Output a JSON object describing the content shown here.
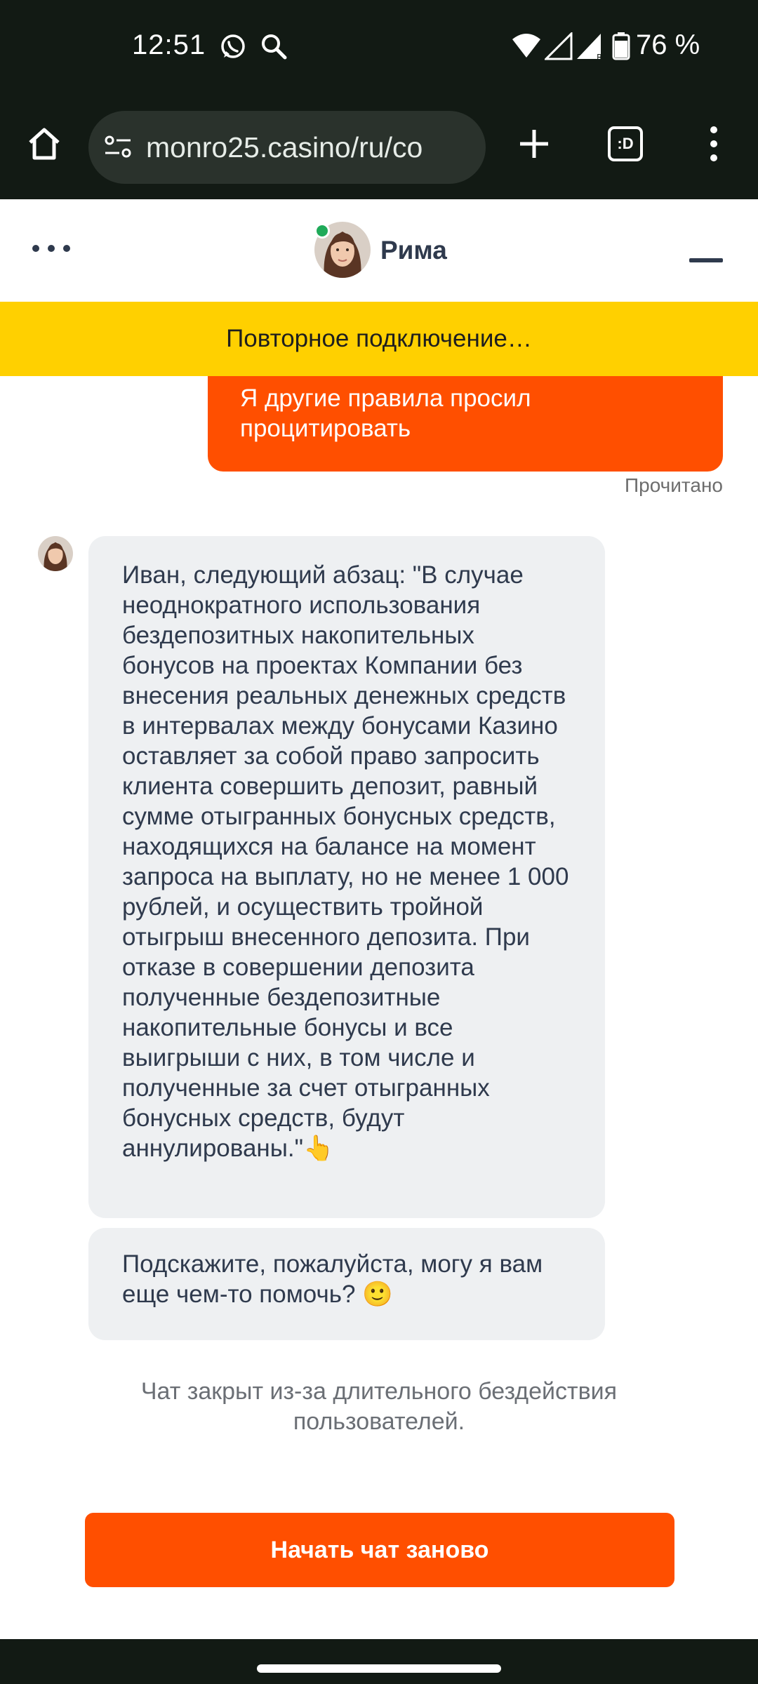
{
  "status_bar": {
    "time": "12:51",
    "battery": "76 %",
    "icons": [
      "whatsapp-icon",
      "search-icon",
      "wifi-icon",
      "signal-icon",
      "signal-roaming-icon",
      "battery-icon"
    ]
  },
  "browser": {
    "url": "monro25.casino/ru/co",
    "tab_count": ":D",
    "icons": [
      "home-icon",
      "site-settings-icon",
      "new-tab-icon",
      "tab-switcher-icon",
      "overflow-menu-icon"
    ]
  },
  "chat": {
    "agent_name": "Рима",
    "reconnect_banner": "Повторное подключение…",
    "user_message": "Я другие правила просил процитировать",
    "read_status": "Прочитано",
    "agent_messages": [
      "Иван, следующий абзац: \"В случае неоднократного использования бездепозитных накопительных бонусов на проектах Компании без внесения реальных денежных средств в интервалах между бонусами Казино оставляет за собой право запросить клиента совершить депозит, равный сумме отыгранных бонусных средств, находящихся на балансе на момент запроса на выплату, но не менее 1 000 рублей, и осуществить тройной отыгрыш внесенного депозита. При отказе в совершении депозита полученные бездепозитные накопительные бонусы и все выигрыши с них, в том числе и полученные за счет отыгранных бонусных средств, будут аннулированы.\"👆",
      "Подскажите, пожалуйста, могу я вам еще чем-то помочь? 🙂"
    ],
    "closed_note": "Чат закрыт из-за длительного бездействия пользователей.",
    "restart_button": "Начать чат заново"
  },
  "colors": {
    "accent": "#ff4f00",
    "banner": "#ffd000",
    "online": "#1faa59",
    "bubble_bg": "#eef0f2",
    "text_dark": "#2f3a4d"
  }
}
